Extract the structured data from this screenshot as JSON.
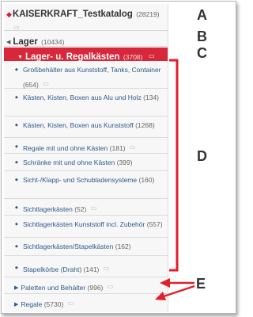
{
  "catalog": {
    "name": "KAISERKRAFT_Testkatalog",
    "count": "(28219)"
  },
  "lager": {
    "name": "Lager",
    "count": "(10434)"
  },
  "regal": {
    "name": "Lager- u. Regalkästen",
    "count": "(3708)"
  },
  "items": [
    {
      "label": "Großbehälter aus Kunststoff, Tanks, Container",
      "count": "(654)"
    },
    {
      "label": "Kästen, Kisten, Boxen aus Alu und Holz",
      "count": "(134)"
    },
    {
      "label": "Kästen, Kisten, Boxen aus Kunststoff",
      "count": "(1268)"
    },
    {
      "label": "Regale mit und ohne Kästen",
      "count": "(181)"
    },
    {
      "label": "Schränke mit und ohne Kästen",
      "count": "(399)"
    },
    {
      "label": "Sicht-/Klapp- und Schubladensysteme",
      "count": "(160)"
    },
    {
      "label": "Sichtlagerkästen",
      "count": "(52)"
    },
    {
      "label": "Sichtlagerkästen Kunststoff incl. Zubehör",
      "count": "(557)"
    },
    {
      "label": "Sichtlagerkästen/Stapelkästen",
      "count": "(162)"
    },
    {
      "label": "Stapelkörbe (Draht)",
      "count": "(141)"
    }
  ],
  "subs": [
    {
      "label": "Paletten und Behälter",
      "count": "(996)"
    },
    {
      "label": "Regale",
      "count": "(5730)"
    }
  ],
  "annotations": {
    "a": "A",
    "b": "B",
    "c": "C",
    "d": "D",
    "e": "E"
  },
  "colors": {
    "accent": "#d8263a",
    "link": "#2c5a8a",
    "annotation": "#e0202a"
  }
}
